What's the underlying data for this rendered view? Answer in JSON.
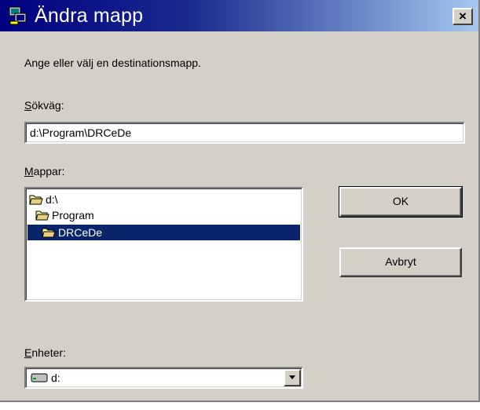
{
  "window": {
    "title": "Ändra mapp",
    "close_label": "×"
  },
  "instruction": "Ange eller välj en destinationsmapp.",
  "path": {
    "label": "Sökväg:",
    "value": "d:\\Program\\DRCeDe"
  },
  "folders": {
    "label": "Mappar:",
    "items": [
      {
        "label": "d:\\",
        "selected": false
      },
      {
        "label": "Program",
        "selected": false
      },
      {
        "label": "DRCeDe",
        "selected": true
      }
    ]
  },
  "buttons": {
    "ok": "OK",
    "cancel": "Avbryt"
  },
  "drives": {
    "label": "Enheter:",
    "selected": "d:"
  },
  "colors": {
    "title_start": "#000080",
    "title_end": "#a6c8f0",
    "face": "#d4d0c8",
    "selection": "#0a246a"
  },
  "icons": {
    "title": "computer-icon",
    "folder": "open-folder-icon",
    "drive": "hard-drive-icon",
    "dropdown": "chevron-down-icon"
  }
}
